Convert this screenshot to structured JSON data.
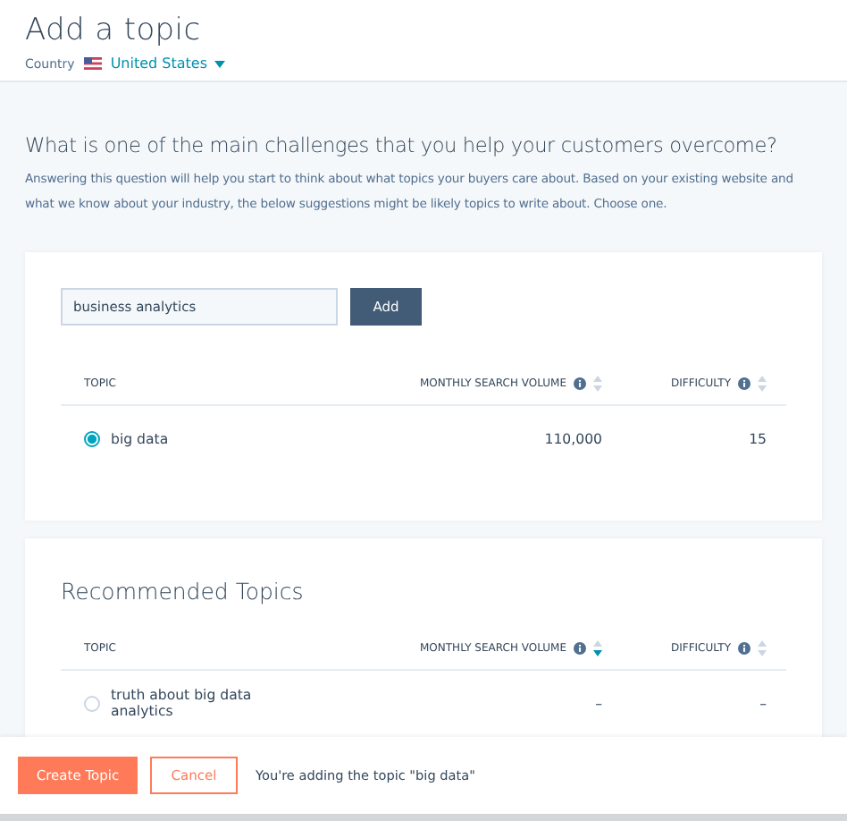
{
  "header": {
    "title": "Add a topic",
    "country_label": "Country",
    "country": "United States"
  },
  "question": {
    "heading": "What is one of the main challenges that you help your customers overcome?",
    "description": "Answering this question will help you start to think about what topics your buyers care about. Based on your existing website and what we know about your industry, the below suggestions might be likely topics to write about. Choose one."
  },
  "search": {
    "value": "business analytics",
    "button": "Add"
  },
  "results": {
    "columns": [
      {
        "label": "TOPIC",
        "kind": "text"
      },
      {
        "label": "MONTHLY SEARCH VOLUME",
        "kind": "sortable",
        "sorted": false
      },
      {
        "label": "DIFFICULTY",
        "kind": "sortable",
        "sorted": false
      }
    ],
    "rows": [
      {
        "topic": "big data",
        "volume": "110,000",
        "difficulty": "15",
        "selected": true
      }
    ]
  },
  "recommended": {
    "title": "Recommended Topics",
    "columns": [
      {
        "label": "TOPIC",
        "kind": "text"
      },
      {
        "label": "MONTHLY SEARCH VOLUME",
        "kind": "sortable",
        "sorted": true
      },
      {
        "label": "DIFFICULTY",
        "kind": "sortable",
        "sorted": false
      }
    ],
    "rows": [
      {
        "topic": "truth about big data analytics",
        "volume": "–",
        "difficulty": "–",
        "selected": false
      }
    ]
  },
  "footer": {
    "primary": "Create Topic",
    "secondary": "Cancel",
    "message": "You're adding the topic \"big data\""
  }
}
